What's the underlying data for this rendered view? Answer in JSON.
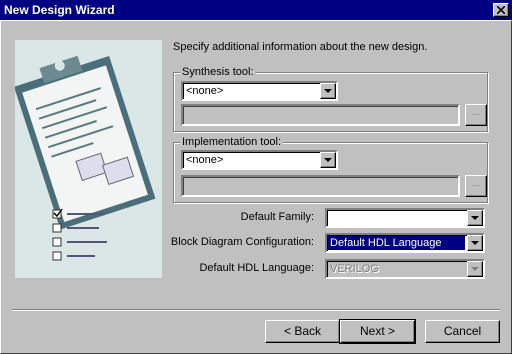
{
  "window": {
    "title": "New Design Wizard"
  },
  "header": {
    "text": "Specify additional information about the new design."
  },
  "synthesis": {
    "label": "Synthesis tool:",
    "selected": "<none>",
    "browse_label": "..."
  },
  "implementation": {
    "label": "Implementation tool:",
    "selected": "<none>",
    "browse_label": "..."
  },
  "options": {
    "family_label": "Default Family:",
    "family_value": "",
    "block_label": "Block Diagram Configuration:",
    "block_value": "Default HDL Language",
    "hdl_label": "Default HDL Language:",
    "hdl_value": "VERILOG"
  },
  "buttons": {
    "back": "< Back",
    "next": "Next >",
    "cancel": "Cancel"
  },
  "colors": {
    "titlebar": "#000080",
    "face": "#c0c0c0",
    "selection": "#000080"
  },
  "icons": [
    "close-icon",
    "dropdown-arrow-icon",
    "clipboard-illustration"
  ]
}
